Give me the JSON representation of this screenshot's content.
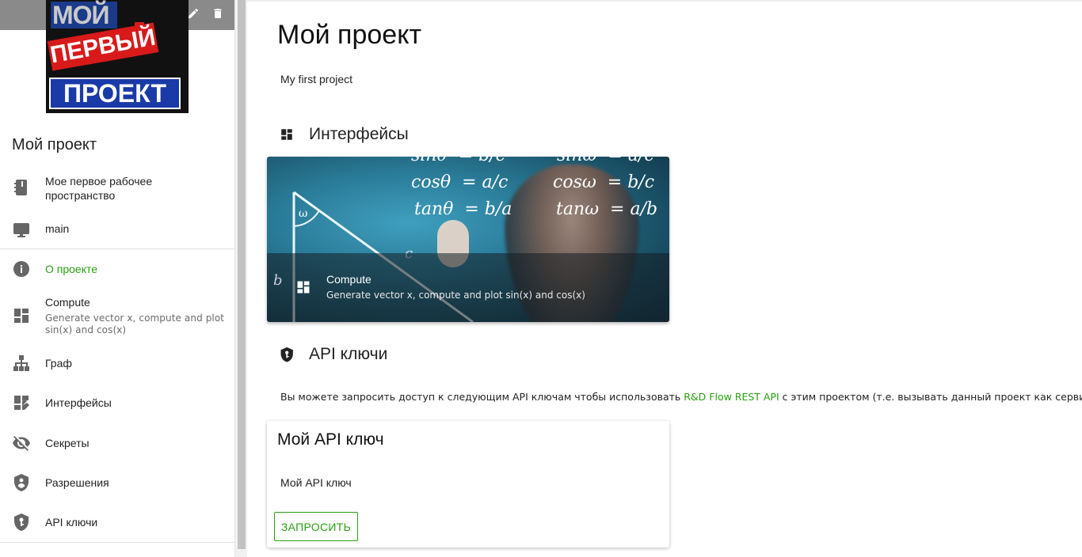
{
  "sidebar": {
    "logo": {
      "line1": "МОЙ",
      "line2": "ПЕРВЫЙ",
      "line3": "ПРОЕКТ"
    },
    "project_title": "Мой проект",
    "items": [
      {
        "label": "Мое первое рабочее",
        "label2": "пространство",
        "icon": "notebook-icon"
      },
      {
        "label": "main",
        "icon": "computer-icon"
      },
      {
        "label": "О проекте",
        "icon": "info-icon",
        "active": true
      },
      {
        "label": "Compute",
        "sub": "Generate vector x, compute and plot",
        "sub2": "sin(x) and cos(x)",
        "icon": "dashboard-icon"
      },
      {
        "label": "Граф",
        "icon": "sitemap-icon"
      },
      {
        "label": "Интерфейсы",
        "icon": "dashboard-edit-icon"
      },
      {
        "label": "Секреты",
        "icon": "eye-off-icon"
      },
      {
        "label": "Разрешения",
        "icon": "shield-account-icon"
      },
      {
        "label": "API ключи",
        "icon": "shield-key-icon"
      }
    ]
  },
  "main": {
    "title": "Мой проект",
    "description": "My first project",
    "interfaces_heading": "Интерфейсы",
    "interface_card": {
      "title": "Compute",
      "subtitle": "Generate vector x, compute and plot sin(x) and cos(x)",
      "formulas": {
        "f1": "sinθ  = b/c",
        "f2": "cosθ  = a/c",
        "f3": "tanθ  = b/a",
        "f4": "sinω  = a/c",
        "f5": "cosω  = b/c",
        "f6": "tanω  = a/b",
        "b": "b",
        "c": "c",
        "w": "ω"
      }
    },
    "api_heading": "API ключи",
    "api_text_before": "Вы можете запросить доступ к следующим API ключам чтобы использовать ",
    "api_text_link": "R&D Flow REST API",
    "api_text_after": " с этим проектом (т.е. вызывать данный проект как сервис):",
    "api_card": {
      "title": "Мой API ключ",
      "text": "Мой API ключ",
      "button": "ЗАПРОСИТЬ"
    }
  },
  "colors": {
    "accent": "#28a012",
    "overlay": "#8a8a8a"
  }
}
